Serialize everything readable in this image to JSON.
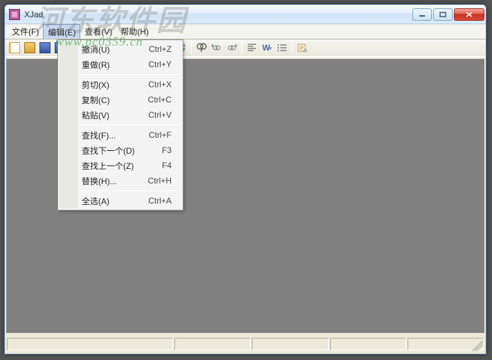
{
  "window": {
    "title": "XJad"
  },
  "menubar": {
    "items": [
      {
        "label": "文件(F)"
      },
      {
        "label": "编辑(E)"
      },
      {
        "label": "查看(V)"
      },
      {
        "label": "帮助(H)"
      }
    ],
    "active_index": 1
  },
  "edit_menu": {
    "groups": [
      [
        {
          "label": "撤消(U)",
          "shortcut": "Ctrl+Z"
        },
        {
          "label": "重做(R)",
          "shortcut": "Ctrl+Y"
        }
      ],
      [
        {
          "label": "剪切(X)",
          "shortcut": "Ctrl+X"
        },
        {
          "label": "复制(C)",
          "shortcut": "Ctrl+C"
        },
        {
          "label": "粘贴(V)",
          "shortcut": "Ctrl+V"
        }
      ],
      [
        {
          "label": "查找(F)...",
          "shortcut": "Ctrl+F"
        },
        {
          "label": "查找下一个(D)",
          "shortcut": "F3"
        },
        {
          "label": "查找上一个(Z)",
          "shortcut": "F4"
        },
        {
          "label": "替换(H)...",
          "shortcut": "Ctrl+H"
        }
      ],
      [
        {
          "label": "全选(A)",
          "shortcut": "Ctrl+A"
        }
      ]
    ]
  },
  "toolbar": {
    "groups": [
      [
        "new-icon",
        "open-icon",
        "save-icon",
        "save-all-icon"
      ],
      [
        "cut-icon",
        "copy-icon",
        "paste-icon"
      ],
      [
        "print-icon",
        "print-preview-icon"
      ],
      [
        "undo-icon",
        "redo-icon"
      ],
      [
        "find-icon",
        "find-prev-icon",
        "find-next-icon"
      ],
      [
        "align-left-icon",
        "wrap-icon",
        "list-icon"
      ],
      [
        "settings-icon"
      ]
    ]
  },
  "watermark": {
    "big": "河东软件园",
    "url": "www.pc0359.cn"
  }
}
